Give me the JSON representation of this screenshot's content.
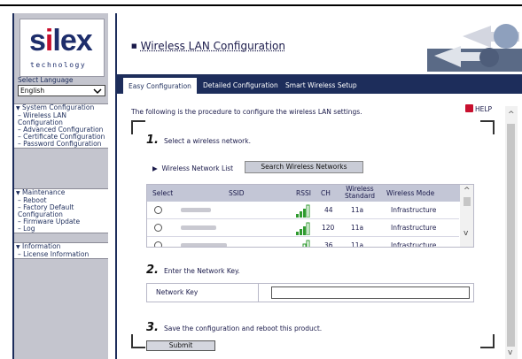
{
  "brand": {
    "logo": "silex",
    "tagline": "technology"
  },
  "language": {
    "label": "Select Language",
    "selected": "English"
  },
  "sidebar": {
    "groups": [
      {
        "head": "System Configuration",
        "items": [
          "Wireless LAN Configuration",
          "Advanced Configuration",
          "Certificate Configuration",
          "Password Configuration"
        ]
      },
      {
        "head": "Maintenance",
        "items": [
          "Reboot",
          "Factory Default Configuration",
          "Firmware Update",
          "Log"
        ]
      },
      {
        "head": "Information",
        "items": [
          "License Information"
        ]
      }
    ]
  },
  "header": {
    "title": "Wireless LAN Configuration"
  },
  "tabs": [
    "Easy Configuration",
    "Detailed Configuration",
    "Smart Wireless Setup"
  ],
  "intro": "The following is the procedure to configure the wireless LAN settings.",
  "help_label": "HELP",
  "steps": [
    {
      "num": "1.",
      "text": "Select a wireless network."
    },
    {
      "num": "2.",
      "text": "Enter the Network Key."
    },
    {
      "num": "3.",
      "text": "Save the configuration and reboot this product."
    }
  ],
  "network_list": {
    "label": "Wireless Network List",
    "search_button": "Search Wireless Networks"
  },
  "table": {
    "headers": [
      "Select",
      "SSID",
      "RSSI",
      "CH",
      "Wireless Standard",
      "Wireless Mode"
    ],
    "rows": [
      {
        "ch": "44",
        "standard": "11a",
        "mode": "Infrastructure"
      },
      {
        "ch": "120",
        "standard": "11a",
        "mode": "Infrastructure"
      },
      {
        "ch": "36",
        "standard": "11a",
        "mode": "Infrastructure"
      }
    ]
  },
  "network_key": {
    "label": "Network Key",
    "value": ""
  },
  "submit_label": "Submit",
  "colors": {
    "navy": "#1d2d5b",
    "sidebar_bg": "#c4c5ce",
    "signal_green": "#2e9a2e",
    "logo_red": "#c8102e"
  },
  "icons": [
    "chevron-down-icon",
    "help-icon",
    "signal-strength-icon",
    "radio-icon",
    "scroll-up-icon",
    "scroll-down-icon"
  ]
}
